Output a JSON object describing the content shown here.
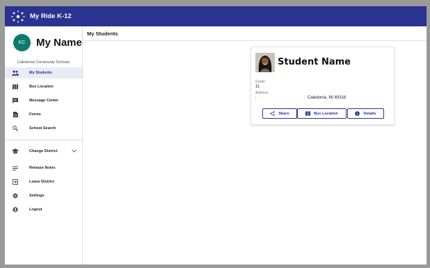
{
  "app": {
    "title": "My Ride K-12"
  },
  "profile": {
    "initials": "KC",
    "name": "My Name",
    "district": "Caledonia Community Schools"
  },
  "nav": {
    "primary": [
      {
        "label": "My Students",
        "icon": "people-icon",
        "active": true
      },
      {
        "label": "Bus Location",
        "icon": "map-icon"
      },
      {
        "label": "Message Center",
        "icon": "message-icon"
      },
      {
        "label": "Forms",
        "icon": "form-icon"
      },
      {
        "label": "School Search",
        "icon": "search-icon"
      }
    ],
    "secondary": [
      {
        "label": "Change District",
        "icon": "school-icon"
      },
      {
        "label": "Release Notes",
        "icon": "notes-icon"
      },
      {
        "label": "Leave District",
        "icon": "exit-icon"
      },
      {
        "label": "Settings",
        "icon": "gear-icon"
      },
      {
        "label": "Logout",
        "icon": "account-icon"
      }
    ]
  },
  "main": {
    "title": "My Students"
  },
  "student": {
    "name": "Student Name",
    "grade_label": "Grade",
    "grade": "11",
    "address_label": "Address",
    "address_line1": ",",
    "address_city": "Caledonia, MI 49316"
  },
  "actions": {
    "share": "Share",
    "bus_location": "Bus Location",
    "details": "Details"
  },
  "colors": {
    "brand": "#2b3390",
    "avatar": "#0d7a6b",
    "active_bg": "#e9ebf5"
  }
}
